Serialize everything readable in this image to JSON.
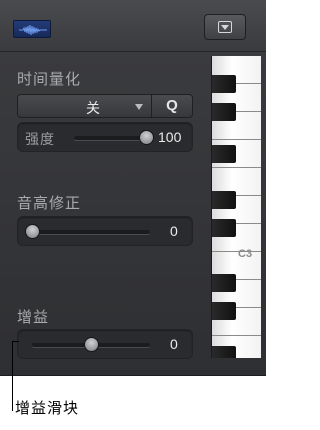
{
  "header": {
    "region_icon": "waveform-icon",
    "collapse_icon": "collapse-menu-icon"
  },
  "quantize": {
    "title": "时间量化",
    "value": "关",
    "q_label": "Q",
    "strength_label": "强度",
    "strength_value": "100",
    "strength_level": 1.0
  },
  "pitch_correction": {
    "title": "音高修正",
    "value": "0",
    "level": 0.0
  },
  "gain": {
    "title": "增益",
    "value": "0",
    "level": 0.5
  },
  "piano": {
    "c_label": "C3"
  },
  "annotation": {
    "text": "增益滑块"
  }
}
